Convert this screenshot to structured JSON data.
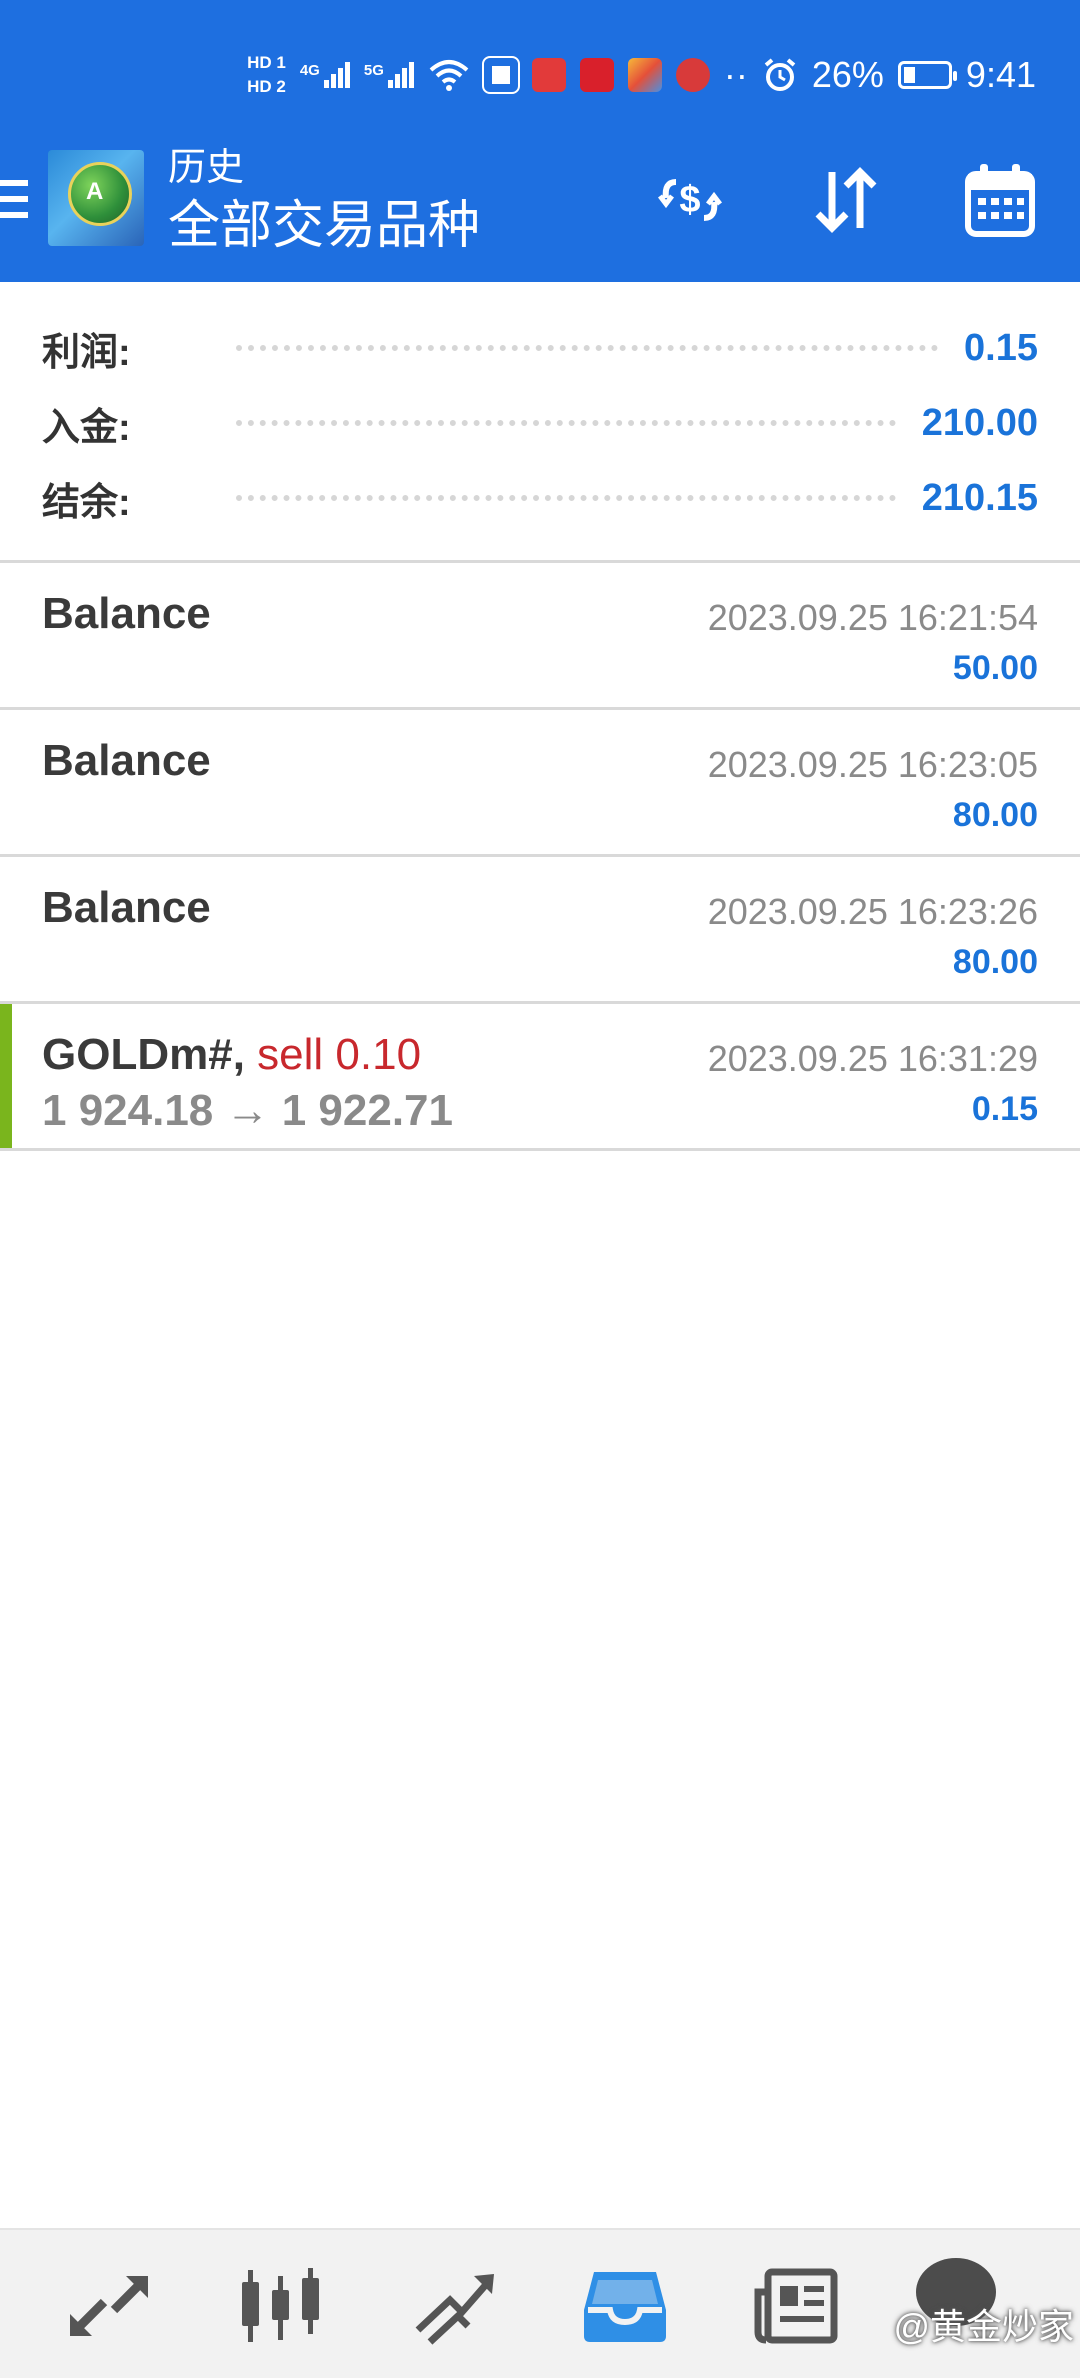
{
  "status_bar": {
    "sim1": "HD 1",
    "sim2": "HD 2",
    "net1": "4G",
    "net2": "5G",
    "battery_percent": "26%",
    "battery_level": 0.26,
    "time": "9:41"
  },
  "app_bar": {
    "subtitle": "历史",
    "title": "全部交易品种",
    "icons": [
      "menu-icon",
      "app-logo",
      "deposit-filter-icon",
      "sort-icon",
      "calendar-icon"
    ]
  },
  "summary": {
    "profit_label": "利润:",
    "profit_value": "0.15",
    "deposit_label": "入金:",
    "deposit_value": "210.00",
    "balance_label": "结余:",
    "balance_value": "210.15"
  },
  "entries": [
    {
      "name": "Balance",
      "time": "2023.09.25 16:21:54",
      "amount": "50.00"
    },
    {
      "name": "Balance",
      "time": "2023.09.25 16:23:05",
      "amount": "80.00"
    },
    {
      "name": "Balance",
      "time": "2023.09.25 16:23:26",
      "amount": "80.00"
    },
    {
      "name": "GOLDm#,",
      "side": "sell 0.10",
      "prices": "1 924.18 → 1 922.71",
      "time": "2023.09.25 16:31:29",
      "amount": "0.15"
    }
  ],
  "bottom_nav": {
    "items": [
      "quotes-icon",
      "chart-icon",
      "trade-icon",
      "history-icon",
      "news-icon",
      "chat-icon"
    ],
    "active": "history-icon",
    "watermark": "@黄金炒家"
  },
  "colors": {
    "header_blue": "#1e6fe0",
    "value_blue": "#1a73d9",
    "sell_red": "#c8282d",
    "accent_green": "#7ab51d"
  }
}
